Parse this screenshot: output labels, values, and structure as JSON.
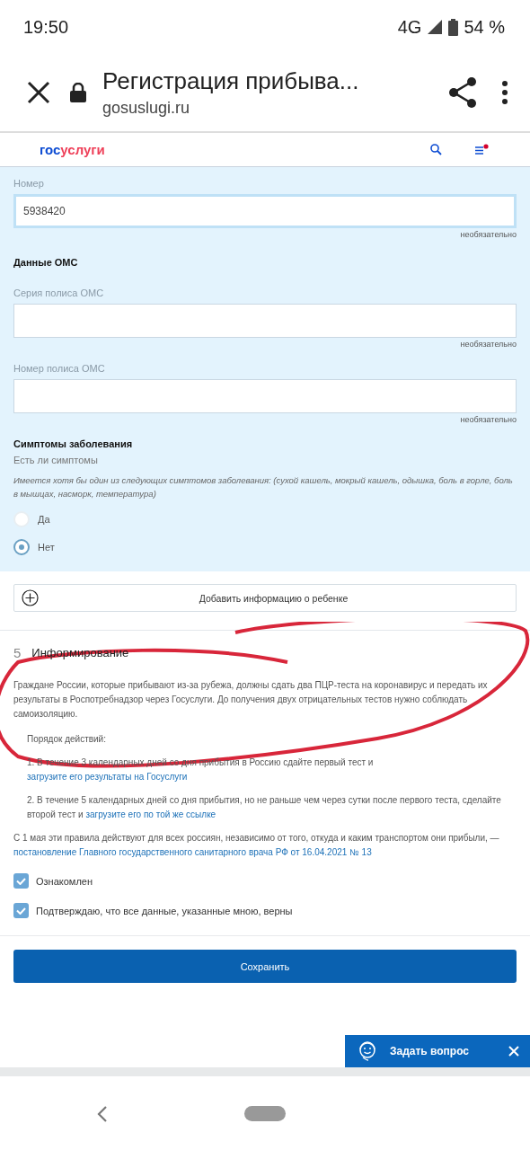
{
  "status_bar": {
    "time": "19:50",
    "network": "4G",
    "battery": "54 %"
  },
  "browser": {
    "title": "Регистрация прибыва...",
    "url": "gosuslugi.ru"
  },
  "site_header": {
    "logo_left": "гос",
    "logo_right": "услуги",
    "notification": true
  },
  "form": {
    "number_field": {
      "label": "Номер",
      "value": "5938420",
      "hint": "необязательно"
    },
    "oms_title": "Данные ОМС",
    "oms_fields": [
      {
        "label": "Серия полиса ОМС",
        "hint": "необязательно"
      },
      {
        "label": "Номер полиса ОМС",
        "hint": "необязательно"
      }
    ],
    "symptoms_title": "Симптомы заболевания",
    "symptoms_question": "Есть ли симптомы",
    "symptoms_note": "Имеется хотя бы один из следующих симптомов заболевания: (сухой кашель, мокрый кашель, одышка, боль в горле, боль в мышцах, насморк, температура)",
    "options": [
      {
        "label": "Да",
        "selected": false
      },
      {
        "label": "Нет",
        "selected": true
      }
    ]
  },
  "add_child_button": "Добавить информацию о ребенке",
  "section": {
    "number": "5",
    "title": "Информирование",
    "intro": "Граждане России, которые прибывают из-за рубежа, должны сдать два ПЦР-теста на коронавирус и передать их результаты в Роспотребнадзор через Госуслуги. До получения двух отрицательных тестов нужно соблюдать самоизоляцию.",
    "steps_title": "Порядок действий:",
    "steps": [
      {
        "text": "1. В течение 3 календарных дней со дня прибытия в Россию сдайте первый тест и ",
        "link": "загрузите его результаты на Госуслуги"
      },
      {
        "text": "2. В течение 5 календарных дней со дня прибытия, но не раньше чем через сутки после первого теста, сделайте второй тест и ",
        "link": "загрузите его по той же ссылке"
      }
    ],
    "rule_text": "С 1 мая эти правила действуют для всех россиян, независимо от того, откуда и каким транспортом они прибыли, — ",
    "rule_link": "постановление Главного государственного санитарного врача РФ от 16.04.2021 № 13",
    "checkboxes": [
      {
        "label": "Ознакомлен",
        "checked": true
      },
      {
        "label": "Подтверждаю, что все данные, указанные мною, верны",
        "checked": true
      }
    ]
  },
  "save_button": "Сохранить",
  "chat_widget": {
    "label": "Задать вопрос"
  }
}
